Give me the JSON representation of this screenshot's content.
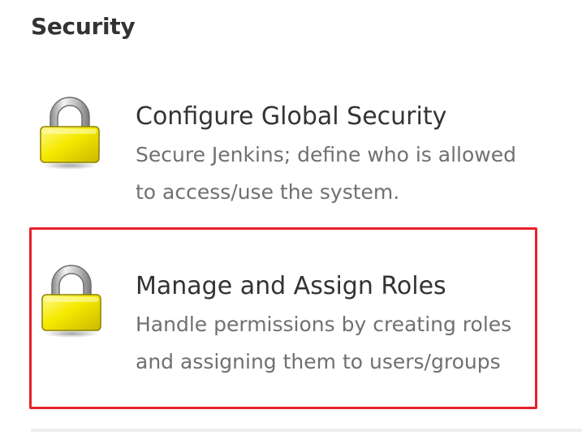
{
  "section": {
    "title": "Security"
  },
  "items": [
    {
      "title": "Configure Global Security",
      "description": "Secure Jenkins; define who is allowed to access/use the system.",
      "icon": "lock-icon"
    },
    {
      "title": "Manage and Assign Roles",
      "description": "Handle permissions by creating roles and assigning them to users/groups",
      "icon": "lock-icon",
      "highlighted": true
    }
  ],
  "colors": {
    "highlight_border": "#e8202a",
    "lock_body": "#f2e600",
    "lock_shackle": "#c8c8c8",
    "title_text": "#333333",
    "description_text": "#707070"
  }
}
